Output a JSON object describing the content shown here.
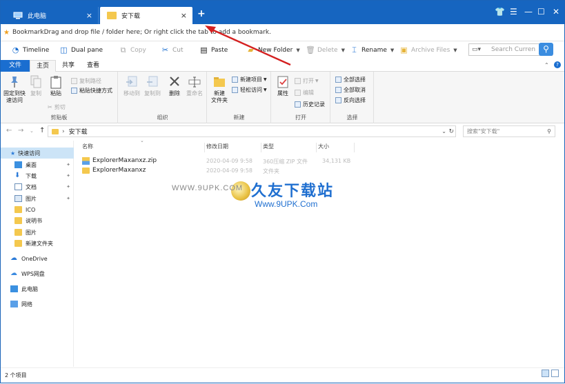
{
  "tabs": [
    {
      "label": "此电脑",
      "close": "×"
    },
    {
      "label": "安下载",
      "close": "×"
    }
  ],
  "new_tab": "+",
  "window_controls": {
    "shirt": "👕",
    "menu": "☰",
    "minimize": "—",
    "maximize": "☐",
    "close": "✕"
  },
  "bookmark_bar": {
    "label": "Bookmark",
    "hint": " Drag and drop file / folder here; Or right click the tab to add a bookmark."
  },
  "toolbar": {
    "timeline": "Timeline",
    "dual_pane": "Dual pane",
    "copy": "Copy",
    "cut": "Cut",
    "paste": "Paste",
    "new_folder": "New Folder",
    "delete": "Delete",
    "rename": "Rename",
    "archive": "Archive Files",
    "search_placeholder": "Search Curren"
  },
  "menu_tabs": [
    "文件",
    "主页",
    "共享",
    "查看"
  ],
  "ribbon": {
    "clipboard": {
      "pin": "固定到快速访问",
      "pin_l1": "固定到快",
      "pin_l2": "速访问",
      "copy": "复制",
      "paste": "粘贴",
      "copy_path": "复制路径",
      "paste_shortcut": "粘贴快捷方式",
      "cut": "剪切",
      "group": "剪贴板"
    },
    "organize": {
      "move_to": "移动到",
      "copy_to": "复制到",
      "delete": "删除",
      "rename": "重命名",
      "group": "组织"
    },
    "new": {
      "new_folder_l1": "新建",
      "new_folder_l2": "文件夹",
      "new_item": "新建项目",
      "easy_access": "轻松访问",
      "group": "新建"
    },
    "open": {
      "properties": "属性",
      "open": "打开",
      "edit": "编辑",
      "history": "历史记录",
      "group": "打开"
    },
    "select": {
      "select_all": "全部选择",
      "select_none": "全部取消",
      "invert": "反向选择",
      "group": "选择"
    }
  },
  "address": {
    "path": "安下载",
    "search_placeholder": "搜索\"安下载\""
  },
  "nav": {
    "quick_access": "快速访问",
    "items": [
      "桌面",
      "下载",
      "文档",
      "图片",
      "ICO",
      "说明书",
      "图片",
      "新建文件夹"
    ],
    "onedrive": "OneDrive",
    "wps": "WPS网盘",
    "this_pc": "此电脑",
    "network": "网络"
  },
  "columns": [
    "名称",
    "修改日期",
    "类型",
    "大小"
  ],
  "files": [
    {
      "name": "ExplorerMaxanxz.zip",
      "date": "2020-04-09 9:58",
      "type": "360压缩 ZIP 文件",
      "size": "34,131 KB"
    },
    {
      "name": "ExplorerMaxanxz",
      "date": "2020-04-09 9:58",
      "type": "文件夹",
      "size": ""
    }
  ],
  "watermark": {
    "url_small": "WWW.9UPK.COM",
    "brand": "久友下载站",
    "url": "Www.9UPK.Com"
  },
  "status": {
    "count": "2 个项目"
  },
  "colors": {
    "title_blue": "#1665c0",
    "accent": "#1a6ed0",
    "arrow_red": "#d42020"
  }
}
